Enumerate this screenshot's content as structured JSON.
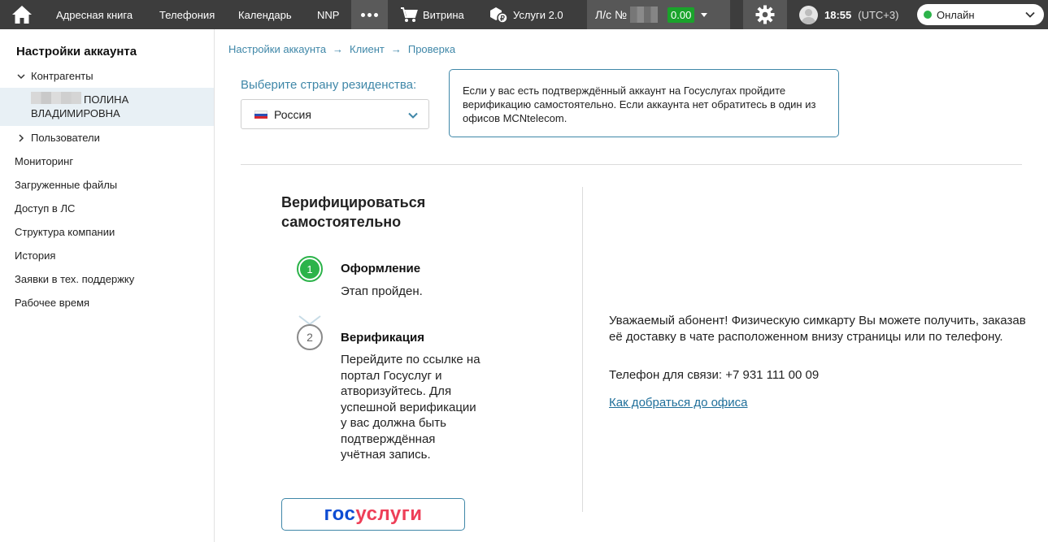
{
  "topbar": {
    "nav": [
      "Адресная книга",
      "Телефония",
      "Календарь",
      "NNP"
    ],
    "more_icon": "more-dots-icon",
    "showcase_label": "Витрина",
    "services_label": "Услуги 2.0",
    "account_label": "Л/с №",
    "balance": "0.00",
    "time": "18:55",
    "timezone": "(UTC+3)",
    "status": "Онлайн",
    "status_color": "#2cb34a",
    "bar_color": "#3d3d3d"
  },
  "sidebar": {
    "title": "Настройки аккаунта",
    "counterparties": "Контрагенты",
    "selected_name_line1": "ПОЛИНА",
    "selected_name_line2": "ВЛАДИМИРОВНА",
    "users": "Пользователи",
    "items": [
      "Мониторинг",
      "Загруженные файлы",
      "Доступ в ЛС",
      "Структура компании",
      "История",
      "Заявки в тех. поддержку",
      "Рабочее время"
    ]
  },
  "breadcrumbs": [
    "Настройки аккаунта",
    "Клиент",
    "Проверка"
  ],
  "country": {
    "label": "Выберите страну резиденства:",
    "value": "Россия"
  },
  "info_text": "Если у вас есть подтверждённый аккаунт на Госуслугах пройдите верификацию самостоятельно. Если аккаунта нет обратитесь в один из офисов MCNtelecom.",
  "self_verify": {
    "title": "Верифицироваться самостоятельно",
    "steps": [
      {
        "number": "1",
        "title": "Оформление",
        "text": "Этап пройден."
      },
      {
        "number": "2",
        "title": "Верификация",
        "text": "Перейдите по ссылке на портал Госуслуг и атворизуйтесь. Для успешной верификации у вас должна быть подтверждённая учётная запись."
      }
    ],
    "gosuslugi_part1": "гос",
    "gosuslugi_part2": "услуги"
  },
  "office_info": {
    "text": "Уважаемый абонент! Физическую симкарту Вы можете получить, заказав её доставку в чате расположенном внизу страницы или по телефону.",
    "phone": "Телефон для связи: +7 931 111 00 09",
    "link": "Как добраться до офиса"
  }
}
